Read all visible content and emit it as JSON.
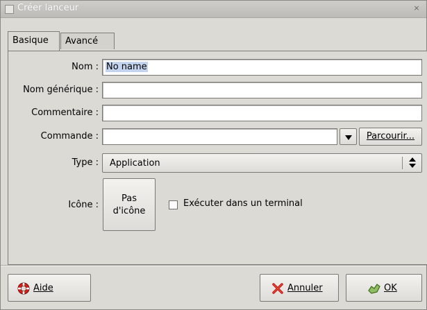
{
  "window": {
    "title": "Créer lanceur",
    "close_glyph": "×"
  },
  "tabs": [
    {
      "label": "Basique",
      "active": true
    },
    {
      "label": "Avancé",
      "active": false
    }
  ],
  "form": {
    "name": {
      "label": "Nom :",
      "value": "No name"
    },
    "generic_name": {
      "label": "Nom générique :",
      "value": ""
    },
    "comment": {
      "label": "Commentaire :",
      "value": ""
    },
    "command": {
      "label": "Commande :",
      "value": "",
      "browse_label": "Parcourir..."
    },
    "type": {
      "label": "Type :",
      "value": "Application"
    },
    "icon": {
      "label": "Icône :",
      "button_line1": "Pas",
      "button_line2": "d'icône"
    },
    "run_in_terminal": {
      "label": "Exécuter dans un terminal",
      "checked": false
    }
  },
  "buttons": {
    "help": {
      "label": "Aide",
      "icon": "lifebuoy-icon"
    },
    "cancel": {
      "label": "Annuler",
      "icon": "cancel-x-icon"
    },
    "ok": {
      "label": "OK",
      "icon": "ok-hand-icon"
    }
  },
  "colors": {
    "window_bg": "#dcdad5",
    "selection": "#c4d4ee"
  }
}
